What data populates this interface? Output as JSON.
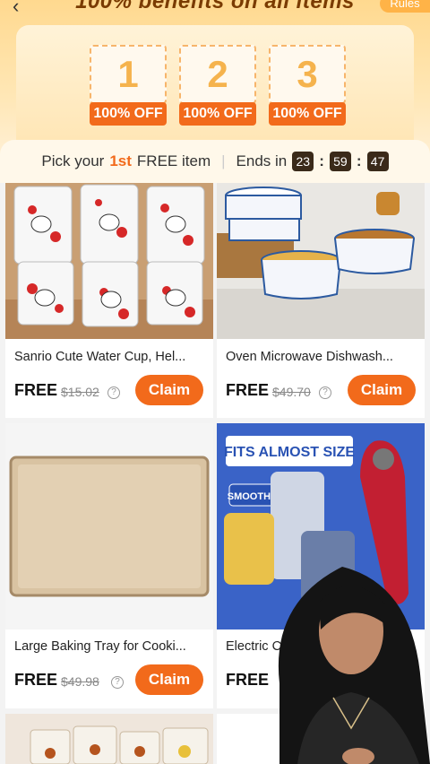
{
  "header": {
    "back_icon": "chevron-left-icon",
    "title": "100% benefits on all items",
    "rules_label": "Rules",
    "steps": [
      {
        "number": "1",
        "tag": "100% OFF"
      },
      {
        "number": "2",
        "tag": "100% OFF"
      },
      {
        "number": "3",
        "tag": "100% OFF"
      }
    ]
  },
  "pick_bar": {
    "prefix": "Pick your",
    "ordinal": "1st",
    "suffix": "FREE item",
    "divider": "|",
    "ends_label": "Ends in",
    "hours": "23",
    "minutes": "59",
    "seconds": "47"
  },
  "products": [
    {
      "name": "Sanrio Cute Water Cup, Hel...",
      "free_label": "FREE",
      "old_price": "$15.02",
      "claim_label": "Claim"
    },
    {
      "name": "Oven Microwave Dishwash...",
      "free_label": "FREE",
      "old_price": "$49.70",
      "claim_label": "Claim"
    },
    {
      "name": "Large Baking Tray for Cooki...",
      "free_label": "FREE",
      "old_price": "$49.98",
      "claim_label": "Claim"
    },
    {
      "name": "Electric Ca",
      "free_label": "FREE",
      "old_price": "",
      "claim_label": ""
    }
  ],
  "promo_image": {
    "headline": "FITS ALMOST SIZE",
    "badge": "SMOOTH EDGE"
  },
  "colors": {
    "accent": "#f26a1b",
    "header_bg": "#ffd98f"
  }
}
